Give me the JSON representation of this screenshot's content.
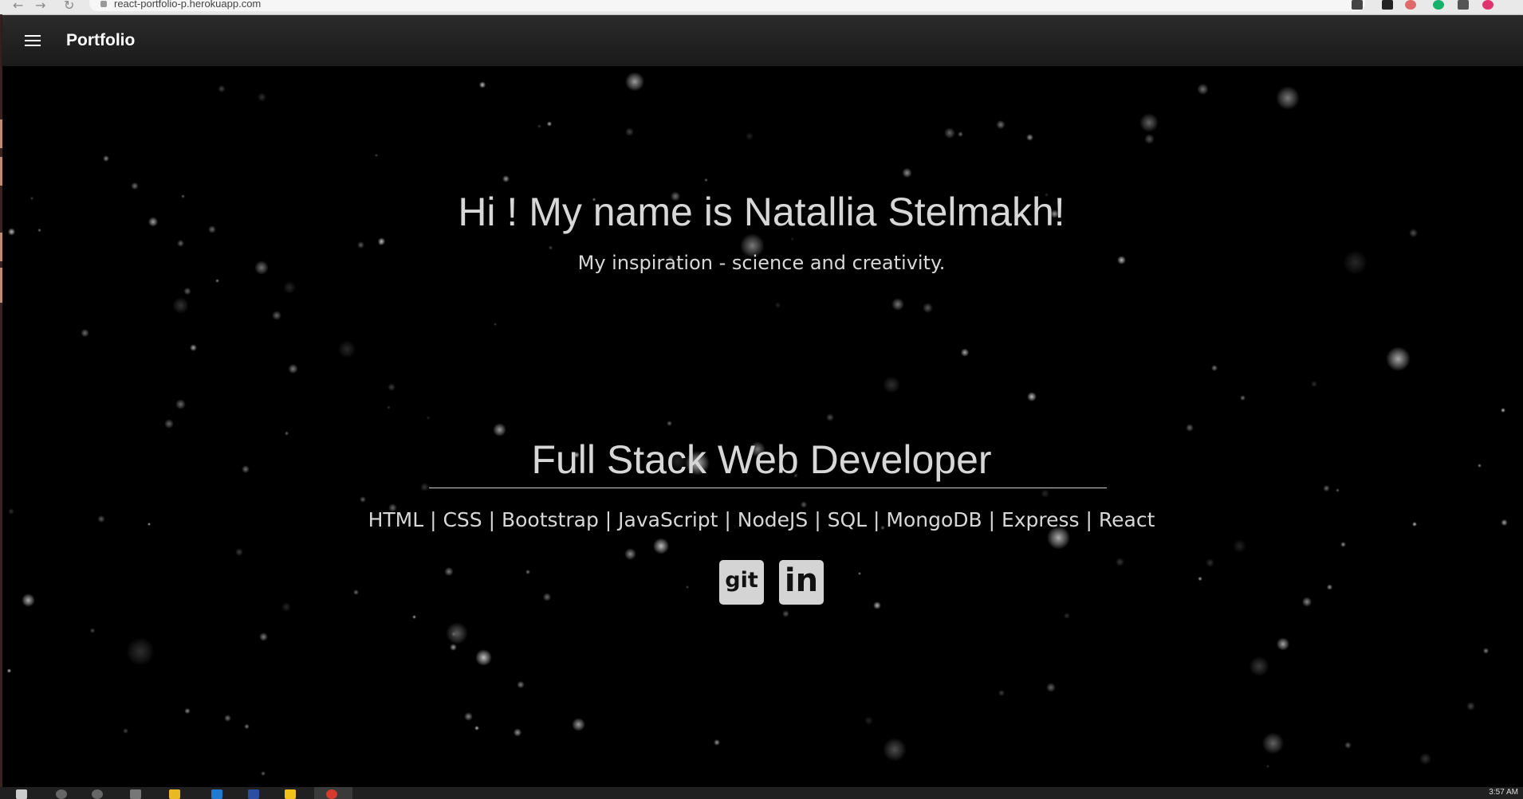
{
  "browser": {
    "url": "react-portfolio-p.herokuapp.com"
  },
  "appbar": {
    "brand": "Portfolio"
  },
  "hero": {
    "greeting": "Hi ! My name is Natallia Stelmakh!",
    "tagline": "My inspiration - science and creativity.",
    "role": "Full Stack Web Developer",
    "skills": "HTML | CSS | Bootstrap | JavaScript | NodeJS | SQL | MongoDB | Express | React"
  },
  "social": {
    "github_label": "git",
    "linkedin_label": "in"
  },
  "taskbar": {
    "clock": "3:57 AM"
  },
  "colors": {
    "background": "#000000",
    "appbar": "#222222",
    "text": "#d7d7d7",
    "icon_tile": "#d4d4d4"
  }
}
